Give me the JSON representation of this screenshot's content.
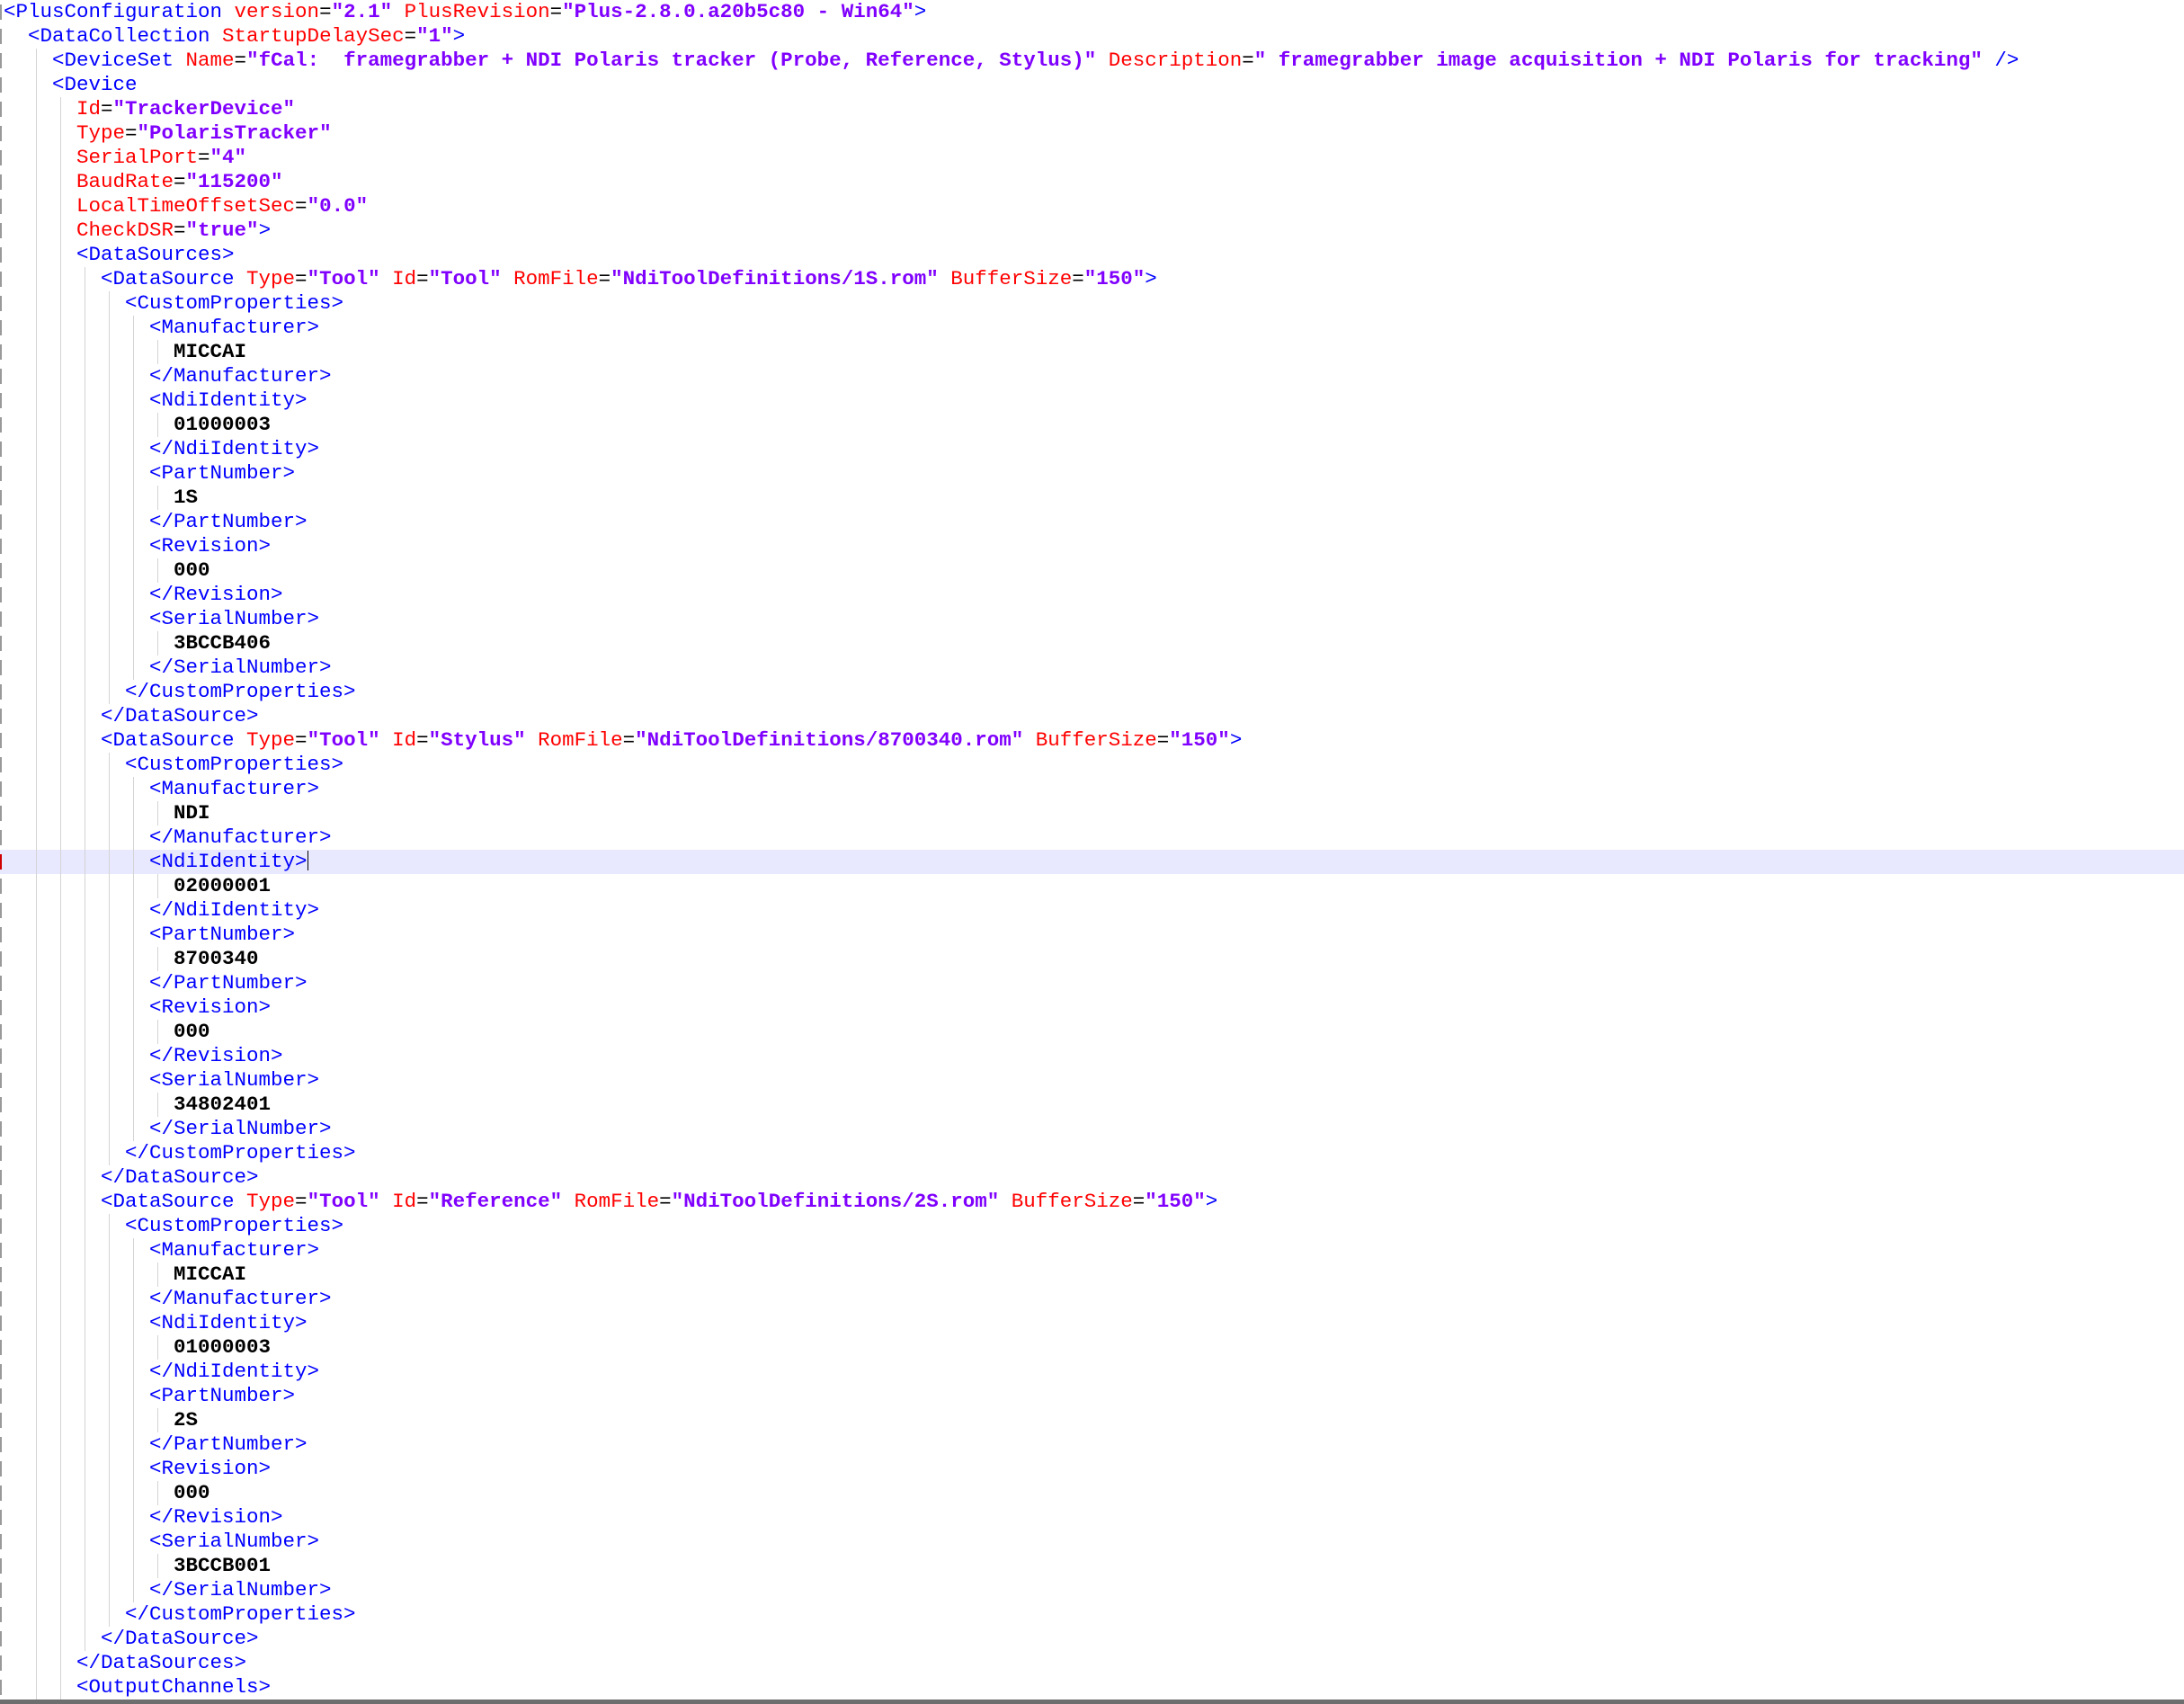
{
  "editor": {
    "current_line": 35,
    "lines": [
      {
        "i": 0,
        "t": [
          [
            "tag",
            "<PlusConfiguration "
          ],
          [
            "attr",
            "version"
          ],
          [
            "eq",
            "="
          ],
          [
            "val",
            "\"2.1\" "
          ],
          [
            "attr",
            "PlusRevision"
          ],
          [
            "eq",
            "="
          ],
          [
            "val",
            "\"Plus-2.8.0.a20b5c80 - Win64\""
          ],
          [
            "tag",
            ">"
          ]
        ]
      },
      {
        "i": 1,
        "t": [
          [
            "tag",
            "<DataCollection "
          ],
          [
            "attr",
            "StartupDelaySec"
          ],
          [
            "eq",
            "="
          ],
          [
            "val",
            "\"1\""
          ],
          [
            "tag",
            ">"
          ]
        ]
      },
      {
        "i": 2,
        "t": [
          [
            "tag",
            "<DeviceSet "
          ],
          [
            "attr",
            "Name"
          ],
          [
            "eq",
            "="
          ],
          [
            "val",
            "\"fCal:  framegrabber + NDI Polaris tracker (Probe, Reference, Stylus)\" "
          ],
          [
            "attr",
            "Description"
          ],
          [
            "eq",
            "="
          ],
          [
            "val",
            "\" framegrabber image acquisition + NDI Polaris for tracking\" "
          ],
          [
            "tag",
            "/>"
          ]
        ]
      },
      {
        "i": 2,
        "t": [
          [
            "tag",
            "<Device"
          ]
        ]
      },
      {
        "i": 3,
        "t": [
          [
            "attr",
            "Id"
          ],
          [
            "eq",
            "="
          ],
          [
            "val",
            "\"TrackerDevice\""
          ]
        ]
      },
      {
        "i": 3,
        "t": [
          [
            "attr",
            "Type"
          ],
          [
            "eq",
            "="
          ],
          [
            "val",
            "\"PolarisTracker\""
          ]
        ]
      },
      {
        "i": 3,
        "t": [
          [
            "attr",
            "SerialPort"
          ],
          [
            "eq",
            "="
          ],
          [
            "val",
            "\"4\""
          ]
        ]
      },
      {
        "i": 3,
        "t": [
          [
            "attr",
            "BaudRate"
          ],
          [
            "eq",
            "="
          ],
          [
            "val",
            "\"115200\""
          ]
        ]
      },
      {
        "i": 3,
        "t": [
          [
            "attr",
            "LocalTimeOffsetSec"
          ],
          [
            "eq",
            "="
          ],
          [
            "val",
            "\"0.0\""
          ]
        ]
      },
      {
        "i": 3,
        "t": [
          [
            "attr",
            "CheckDSR"
          ],
          [
            "eq",
            "="
          ],
          [
            "val",
            "\"true\""
          ],
          [
            "tag",
            ">"
          ]
        ]
      },
      {
        "i": 3,
        "t": [
          [
            "tag",
            "<DataSources>"
          ]
        ]
      },
      {
        "i": 4,
        "t": [
          [
            "tag",
            "<DataSource "
          ],
          [
            "attr",
            "Type"
          ],
          [
            "eq",
            "="
          ],
          [
            "val",
            "\"Tool\" "
          ],
          [
            "attr",
            "Id"
          ],
          [
            "eq",
            "="
          ],
          [
            "val",
            "\"Tool\" "
          ],
          [
            "attr",
            "RomFile"
          ],
          [
            "eq",
            "="
          ],
          [
            "val",
            "\"NdiToolDefinitions/1S.rom\" "
          ],
          [
            "attr",
            "BufferSize"
          ],
          [
            "eq",
            "="
          ],
          [
            "val",
            "\"150\""
          ],
          [
            "tag",
            ">"
          ]
        ]
      },
      {
        "i": 5,
        "t": [
          [
            "tag",
            "<CustomProperties>"
          ]
        ]
      },
      {
        "i": 6,
        "t": [
          [
            "tag",
            "<Manufacturer>"
          ]
        ]
      },
      {
        "i": 7,
        "t": [
          [
            "txt",
            "MICCAI"
          ]
        ]
      },
      {
        "i": 6,
        "t": [
          [
            "tag",
            "</Manufacturer>"
          ]
        ]
      },
      {
        "i": 6,
        "t": [
          [
            "tag",
            "<NdiIdentity>"
          ]
        ]
      },
      {
        "i": 7,
        "t": [
          [
            "txt",
            "01000003"
          ]
        ]
      },
      {
        "i": 6,
        "t": [
          [
            "tag",
            "</NdiIdentity>"
          ]
        ]
      },
      {
        "i": 6,
        "t": [
          [
            "tag",
            "<PartNumber>"
          ]
        ]
      },
      {
        "i": 7,
        "t": [
          [
            "txt",
            "1S"
          ]
        ]
      },
      {
        "i": 6,
        "t": [
          [
            "tag",
            "</PartNumber>"
          ]
        ]
      },
      {
        "i": 6,
        "t": [
          [
            "tag",
            "<Revision>"
          ]
        ]
      },
      {
        "i": 7,
        "t": [
          [
            "txt",
            "000"
          ]
        ]
      },
      {
        "i": 6,
        "t": [
          [
            "tag",
            "</Revision>"
          ]
        ]
      },
      {
        "i": 6,
        "t": [
          [
            "tag",
            "<SerialNumber>"
          ]
        ]
      },
      {
        "i": 7,
        "t": [
          [
            "txt",
            "3BCCB406"
          ]
        ]
      },
      {
        "i": 6,
        "t": [
          [
            "tag",
            "</SerialNumber>"
          ]
        ]
      },
      {
        "i": 5,
        "t": [
          [
            "tag",
            "</CustomProperties>"
          ]
        ]
      },
      {
        "i": 4,
        "t": [
          [
            "tag",
            "</DataSource>"
          ]
        ]
      },
      {
        "i": 4,
        "t": [
          [
            "tag",
            "<DataSource "
          ],
          [
            "attr",
            "Type"
          ],
          [
            "eq",
            "="
          ],
          [
            "val",
            "\"Tool\" "
          ],
          [
            "attr",
            "Id"
          ],
          [
            "eq",
            "="
          ],
          [
            "val",
            "\"Stylus\" "
          ],
          [
            "attr",
            "RomFile"
          ],
          [
            "eq",
            "="
          ],
          [
            "val",
            "\"NdiToolDefinitions/8700340.rom\" "
          ],
          [
            "attr",
            "BufferSize"
          ],
          [
            "eq",
            "="
          ],
          [
            "val",
            "\"150\""
          ],
          [
            "tag",
            ">"
          ]
        ]
      },
      {
        "i": 5,
        "t": [
          [
            "tag",
            "<CustomProperties>"
          ]
        ]
      },
      {
        "i": 6,
        "t": [
          [
            "tag",
            "<Manufacturer>"
          ]
        ]
      },
      {
        "i": 7,
        "t": [
          [
            "txt",
            "NDI"
          ]
        ]
      },
      {
        "i": 6,
        "t": [
          [
            "tag",
            "</Manufacturer>"
          ]
        ]
      },
      {
        "i": 6,
        "t": [
          [
            "tag",
            "<NdiIdentity>"
          ]
        ]
      },
      {
        "i": 7,
        "t": [
          [
            "txt",
            "02000001"
          ]
        ]
      },
      {
        "i": 6,
        "t": [
          [
            "tag",
            "</NdiIdentity>"
          ]
        ]
      },
      {
        "i": 6,
        "t": [
          [
            "tag",
            "<PartNumber>"
          ]
        ]
      },
      {
        "i": 7,
        "t": [
          [
            "txt",
            "8700340"
          ]
        ]
      },
      {
        "i": 6,
        "t": [
          [
            "tag",
            "</PartNumber>"
          ]
        ]
      },
      {
        "i": 6,
        "t": [
          [
            "tag",
            "<Revision>"
          ]
        ]
      },
      {
        "i": 7,
        "t": [
          [
            "txt",
            "000"
          ]
        ]
      },
      {
        "i": 6,
        "t": [
          [
            "tag",
            "</Revision>"
          ]
        ]
      },
      {
        "i": 6,
        "t": [
          [
            "tag",
            "<SerialNumber>"
          ]
        ]
      },
      {
        "i": 7,
        "t": [
          [
            "txt",
            "34802401"
          ]
        ]
      },
      {
        "i": 6,
        "t": [
          [
            "tag",
            "</SerialNumber>"
          ]
        ]
      },
      {
        "i": 5,
        "t": [
          [
            "tag",
            "</CustomProperties>"
          ]
        ]
      },
      {
        "i": 4,
        "t": [
          [
            "tag",
            "</DataSource>"
          ]
        ]
      },
      {
        "i": 4,
        "t": [
          [
            "tag",
            "<DataSource "
          ],
          [
            "attr",
            "Type"
          ],
          [
            "eq",
            "="
          ],
          [
            "val",
            "\"Tool\" "
          ],
          [
            "attr",
            "Id"
          ],
          [
            "eq",
            "="
          ],
          [
            "val",
            "\"Reference\" "
          ],
          [
            "attr",
            "RomFile"
          ],
          [
            "eq",
            "="
          ],
          [
            "val",
            "\"NdiToolDefinitions/2S.rom\" "
          ],
          [
            "attr",
            "BufferSize"
          ],
          [
            "eq",
            "="
          ],
          [
            "val",
            "\"150\""
          ],
          [
            "tag",
            ">"
          ]
        ]
      },
      {
        "i": 5,
        "t": [
          [
            "tag",
            "<CustomProperties>"
          ]
        ]
      },
      {
        "i": 6,
        "t": [
          [
            "tag",
            "<Manufacturer>"
          ]
        ]
      },
      {
        "i": 7,
        "t": [
          [
            "txt",
            "MICCAI"
          ]
        ]
      },
      {
        "i": 6,
        "t": [
          [
            "tag",
            "</Manufacturer>"
          ]
        ]
      },
      {
        "i": 6,
        "t": [
          [
            "tag",
            "<NdiIdentity>"
          ]
        ]
      },
      {
        "i": 7,
        "t": [
          [
            "txt",
            "01000003"
          ]
        ]
      },
      {
        "i": 6,
        "t": [
          [
            "tag",
            "</NdiIdentity>"
          ]
        ]
      },
      {
        "i": 6,
        "t": [
          [
            "tag",
            "<PartNumber>"
          ]
        ]
      },
      {
        "i": 7,
        "t": [
          [
            "txt",
            "2S"
          ]
        ]
      },
      {
        "i": 6,
        "t": [
          [
            "tag",
            "</PartNumber>"
          ]
        ]
      },
      {
        "i": 6,
        "t": [
          [
            "tag",
            "<Revision>"
          ]
        ]
      },
      {
        "i": 7,
        "t": [
          [
            "txt",
            "000"
          ]
        ]
      },
      {
        "i": 6,
        "t": [
          [
            "tag",
            "</Revision>"
          ]
        ]
      },
      {
        "i": 6,
        "t": [
          [
            "tag",
            "<SerialNumber>"
          ]
        ]
      },
      {
        "i": 7,
        "t": [
          [
            "txt",
            "3BCCB001"
          ]
        ]
      },
      {
        "i": 6,
        "t": [
          [
            "tag",
            "</SerialNumber>"
          ]
        ]
      },
      {
        "i": 5,
        "t": [
          [
            "tag",
            "</CustomProperties>"
          ]
        ]
      },
      {
        "i": 4,
        "t": [
          [
            "tag",
            "</DataSource>"
          ]
        ]
      },
      {
        "i": 3,
        "t": [
          [
            "tag",
            "</DataSources>"
          ]
        ]
      },
      {
        "i": 3,
        "t": [
          [
            "tag",
            "<OutputChannels>"
          ]
        ]
      }
    ]
  }
}
